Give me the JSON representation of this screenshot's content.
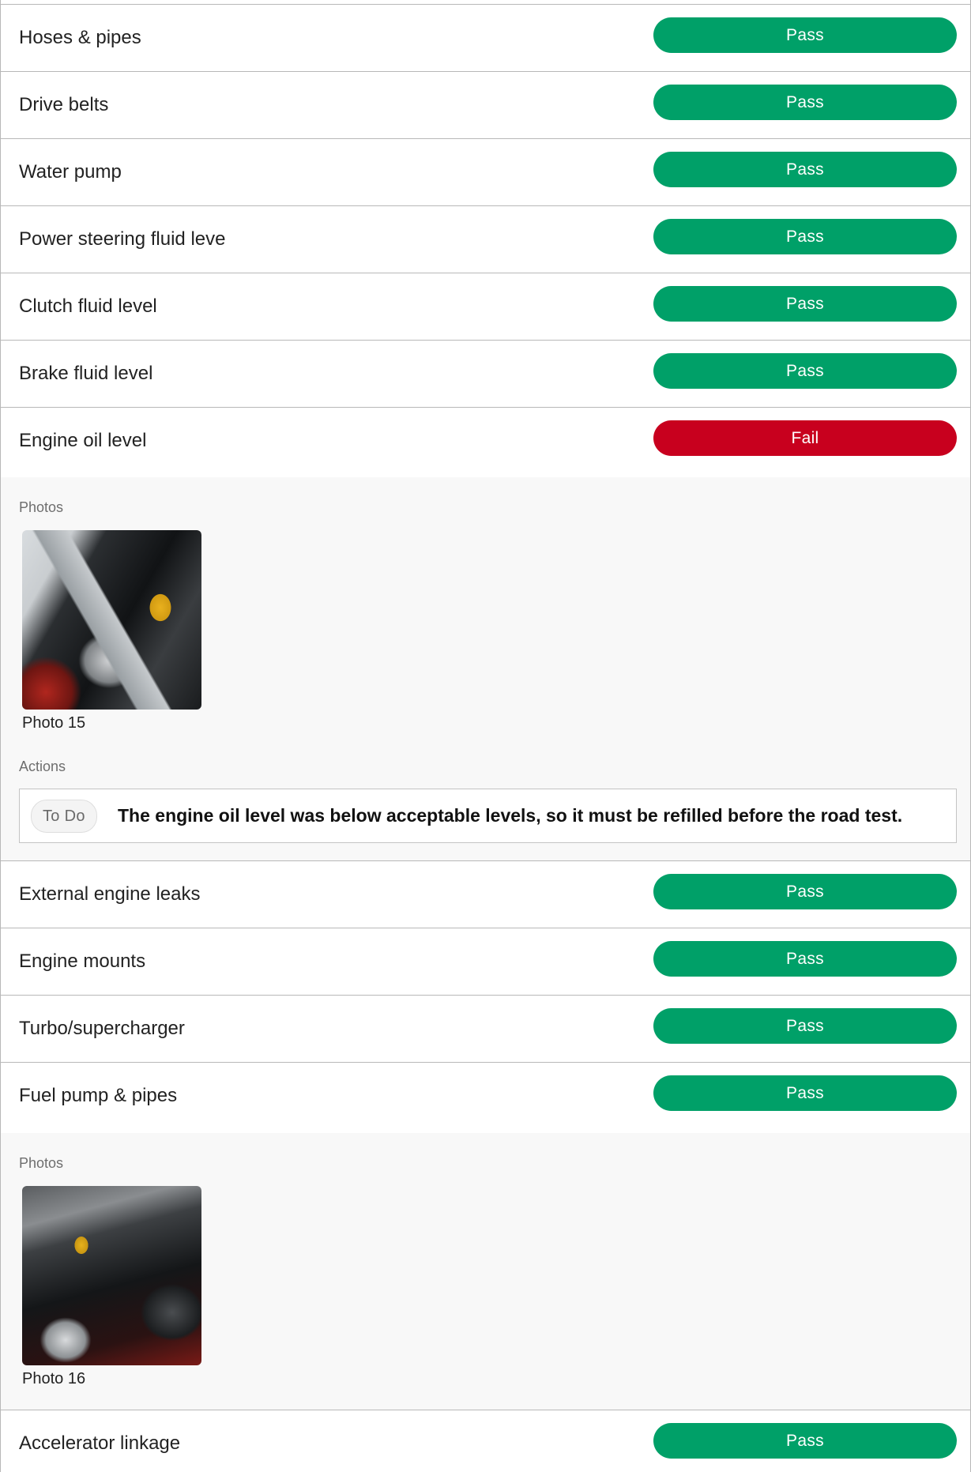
{
  "colors": {
    "pass": "#00a068",
    "fail": "#c8001e",
    "border": "#b8b8b8"
  },
  "items": {
    "hoses": {
      "label": "Hoses & pipes",
      "status": "Pass"
    },
    "belts": {
      "label": "Drive belts",
      "status": "Pass"
    },
    "water_pump": {
      "label": "Water pump",
      "status": "Pass"
    },
    "power_steering": {
      "label": "Power steering fluid leve",
      "status": "Pass"
    },
    "clutch": {
      "label": "Clutch fluid level",
      "status": "Pass"
    },
    "brake": {
      "label": "Brake fluid level",
      "status": "Pass"
    },
    "engine_oil": {
      "label": "Engine oil level",
      "status": "Fail",
      "photos_title": "Photos",
      "photo_caption": "Photo 15",
      "actions_title": "Actions",
      "action_badge": "To Do",
      "action_text": "The engine oil level was below acceptable levels, so it must be refilled before the road test."
    },
    "leaks": {
      "label": "External engine leaks",
      "status": "Pass"
    },
    "mounts": {
      "label": "Engine mounts",
      "status": "Pass"
    },
    "turbo": {
      "label": "Turbo/supercharger",
      "status": "Pass"
    },
    "fuel_pump": {
      "label": "Fuel pump & pipes",
      "status": "Pass",
      "photos_title": "Photos",
      "photo_caption": "Photo 16"
    },
    "accelerator": {
      "label": "Accelerator linkage",
      "status": "Pass"
    }
  }
}
